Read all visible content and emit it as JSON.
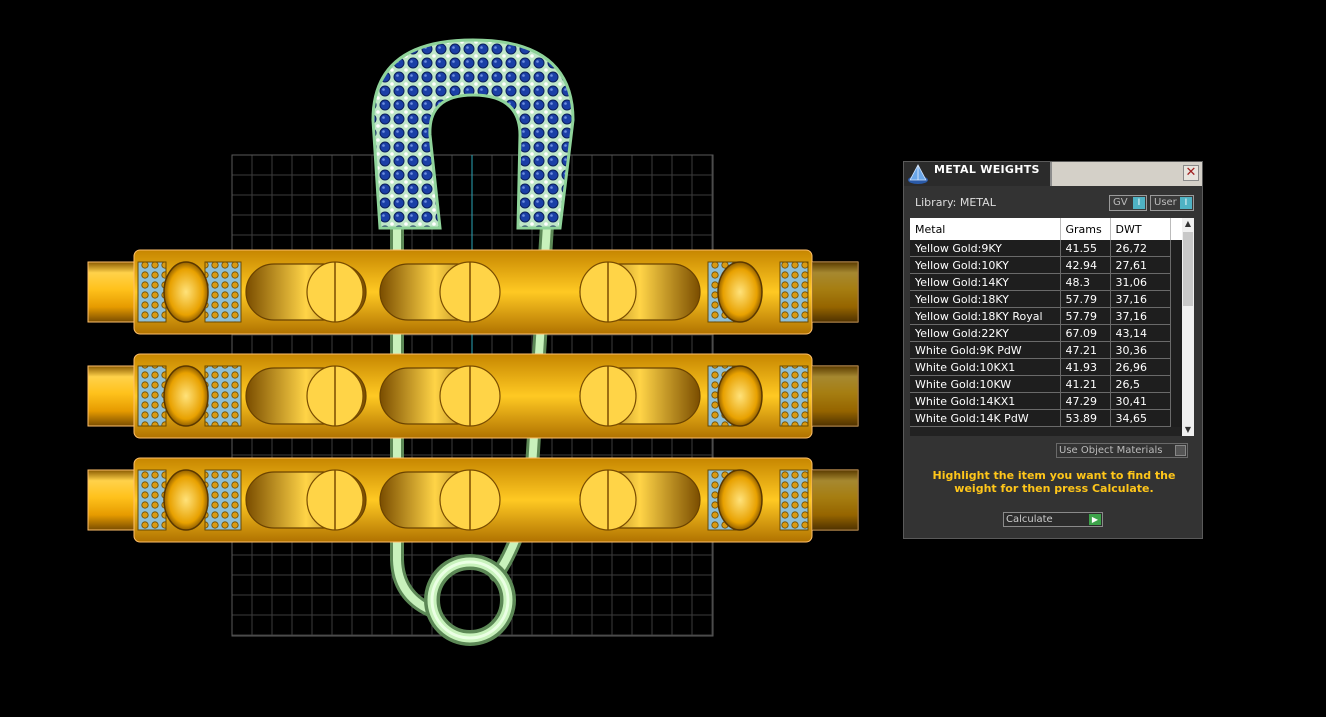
{
  "panel": {
    "title": "METAL WEIGHTS",
    "close_symbol": "✕",
    "library_label": "Library: METAL",
    "toggles": [
      {
        "label": "GV",
        "knob": "I"
      },
      {
        "label": "User",
        "knob": "I"
      }
    ],
    "table": {
      "headers": [
        "Metal",
        "Grams",
        "DWT"
      ],
      "rows": [
        [
          "Yellow Gold:9KY",
          "41.55",
          "26,72"
        ],
        [
          "Yellow Gold:10KY",
          "42.94",
          "27,61"
        ],
        [
          "Yellow Gold:14KY",
          "48.3",
          "31,06"
        ],
        [
          "Yellow Gold:18KY",
          "57.79",
          "37,16"
        ],
        [
          "Yellow Gold:18KY Royal",
          "57.79",
          "37,16"
        ],
        [
          "Yellow Gold:22KY",
          "67.09",
          "43,14"
        ],
        [
          "White Gold:9K PdW",
          "47.21",
          "30,36"
        ],
        [
          "White Gold:10KX1",
          "41.93",
          "26,96"
        ],
        [
          "White Gold:10KW",
          "41.21",
          "26,5"
        ],
        [
          "White Gold:14KX1",
          "47.29",
          "30,41"
        ],
        [
          "White Gold:14K PdW",
          "53.89",
          "34,65"
        ]
      ]
    },
    "use_object_materials": "Use Object Materials",
    "hint": "Highlight the item you want to find the weight for then press Calculate.",
    "calculate_label": "Calculate"
  },
  "colors": {
    "gold": "#f5b20f",
    "gold_dark": "#a86b00",
    "pin": "#b8e6b0",
    "gem_blue": "#1a3fa6",
    "grid": "#3a3a3a",
    "hint": "#ffc61a"
  }
}
